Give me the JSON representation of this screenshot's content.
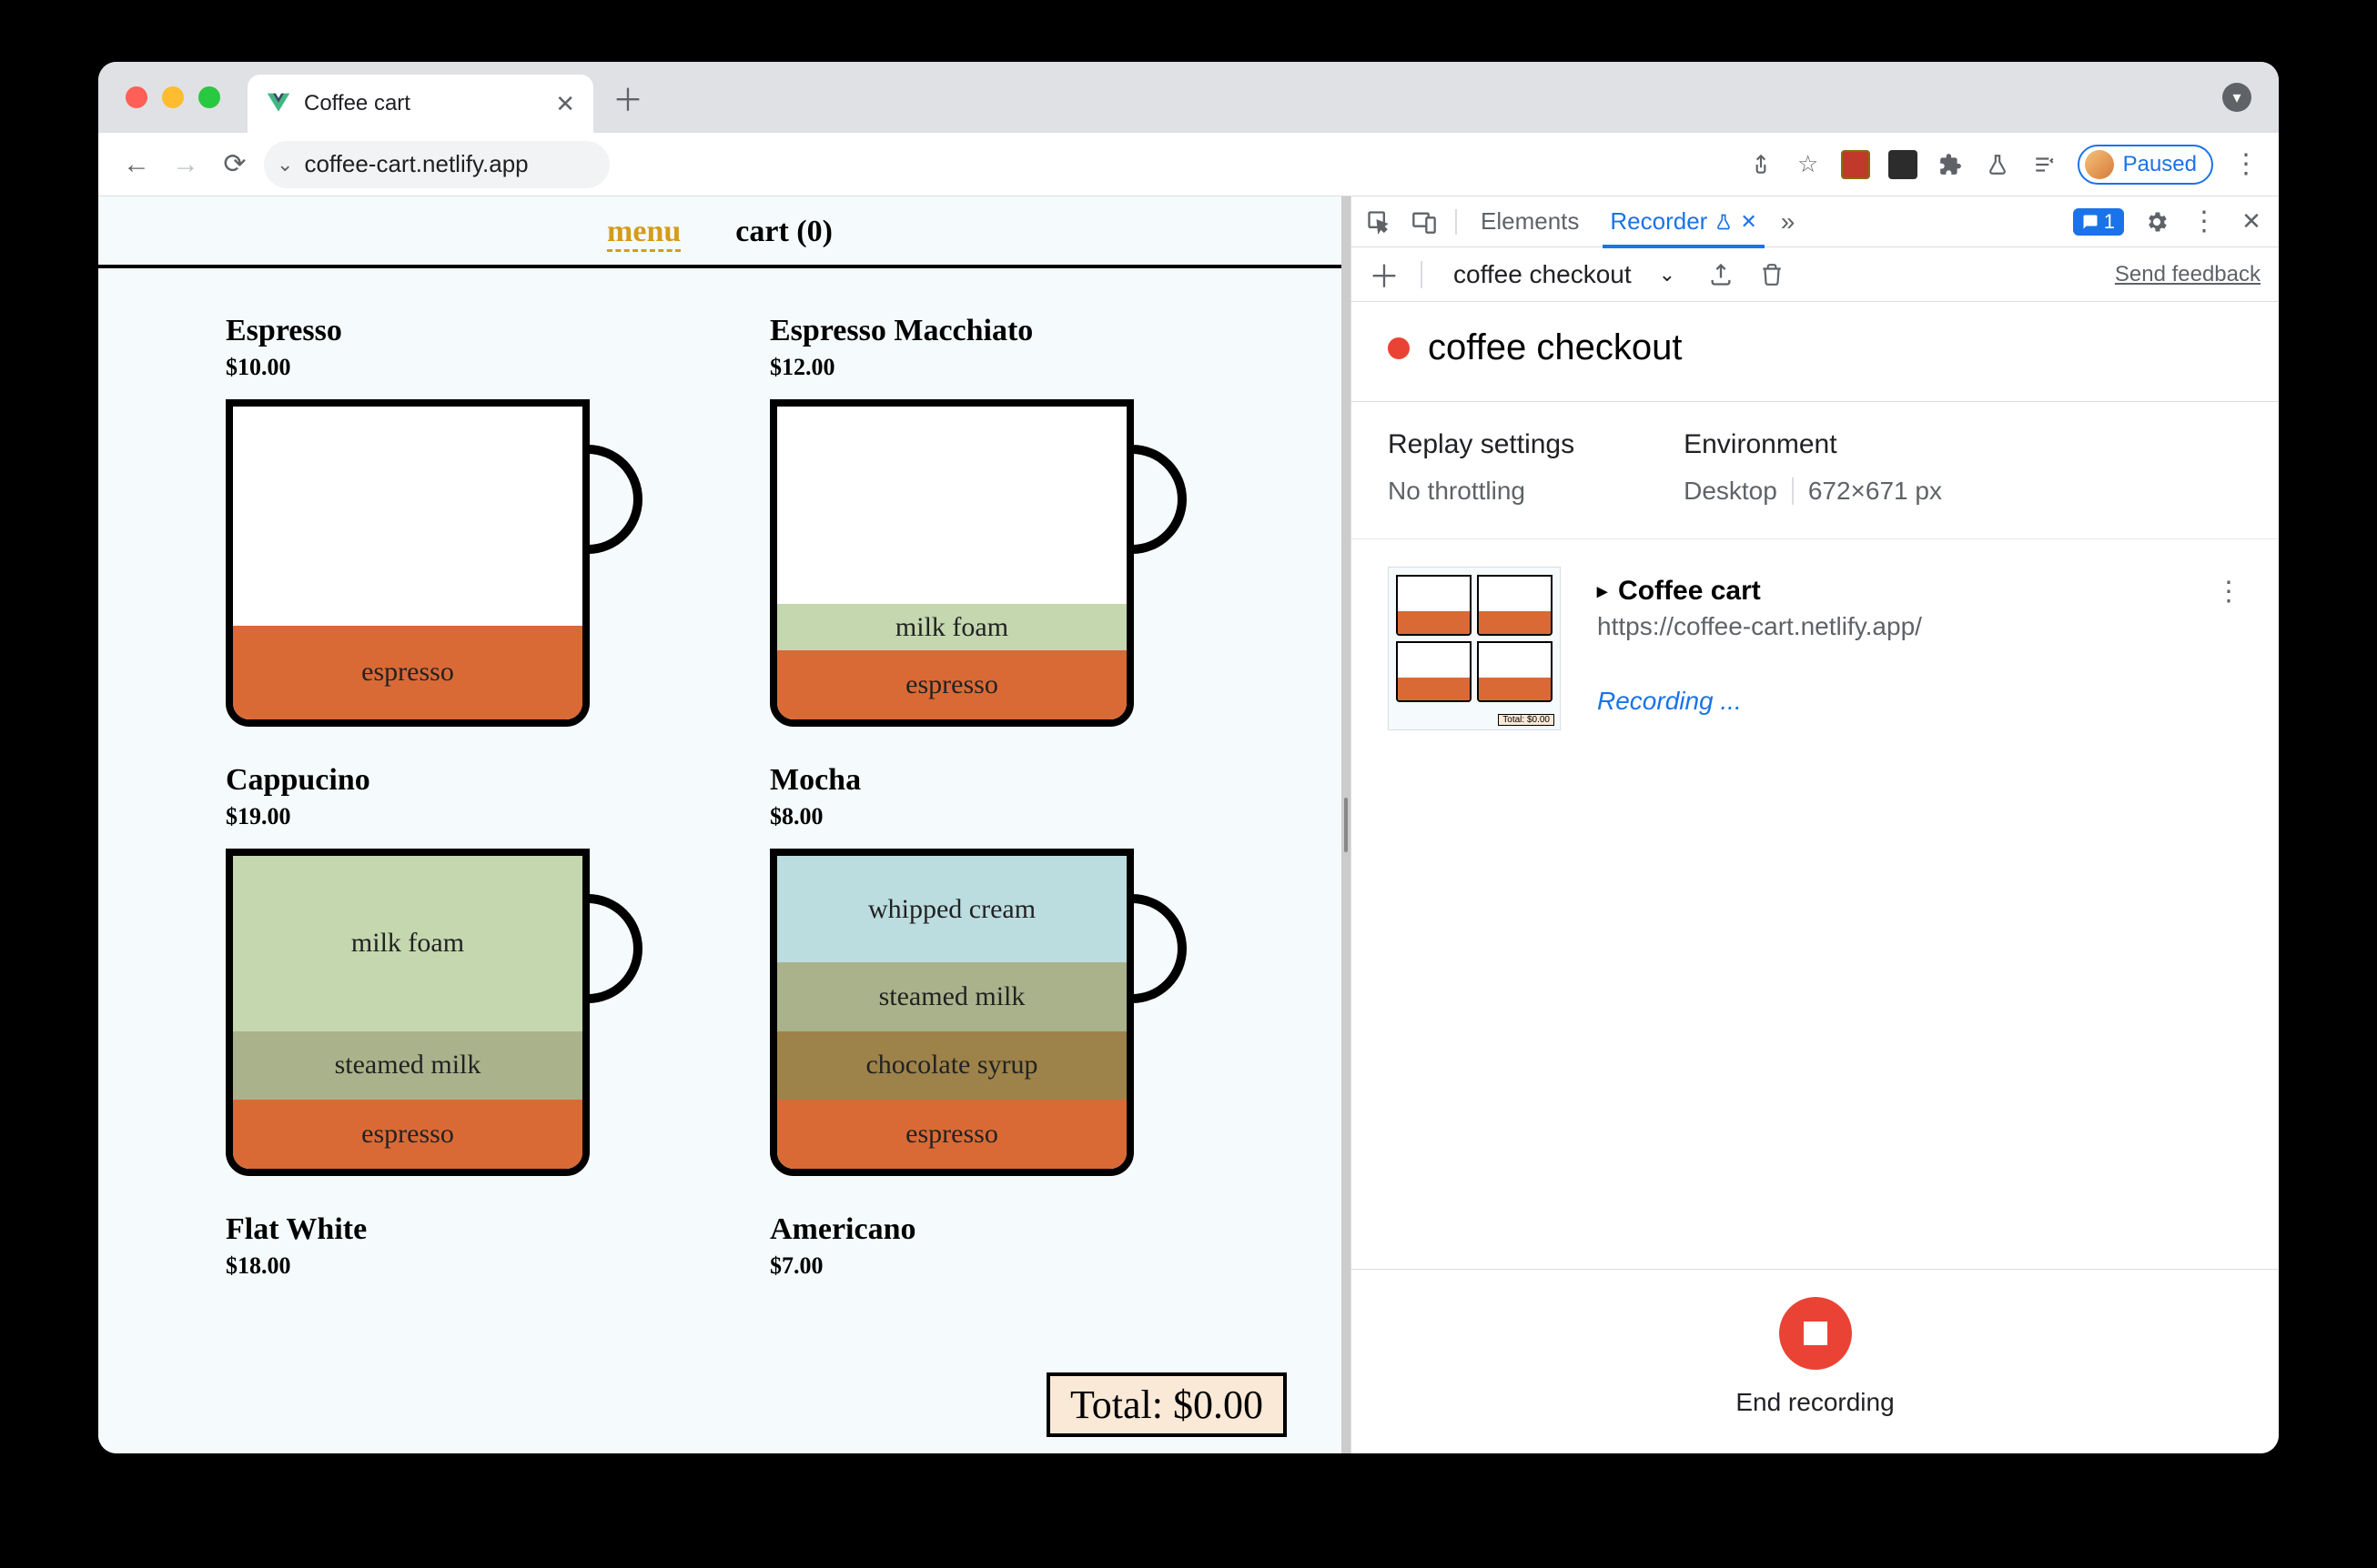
{
  "browser": {
    "tab_title": "Coffee cart",
    "url": "coffee-cart.netlify.app",
    "profile_status": "Paused"
  },
  "page": {
    "nav": {
      "menu_label": "menu",
      "cart_label": "cart (0)"
    },
    "items": [
      {
        "name": "Espresso",
        "price": "$10.00"
      },
      {
        "name": "Espresso Macchiato",
        "price": "$12.00"
      },
      {
        "name": "Cappucino",
        "price": "$19.00"
      },
      {
        "name": "Mocha",
        "price": "$8.00"
      },
      {
        "name": "Flat White",
        "price": "$18.00"
      },
      {
        "name": "Americano",
        "price": "$7.00"
      }
    ],
    "layers": {
      "espresso": "espresso",
      "milk_foam": "milk foam",
      "steamed_milk": "steamed milk",
      "chocolate_syrup": "chocolate syrup",
      "whipped_cream": "whipped cream"
    },
    "total_label": "Total: $0.00"
  },
  "devtools": {
    "tabs": {
      "elements": "Elements",
      "recorder": "Recorder"
    },
    "messages_badge": "1",
    "toolbar": {
      "recording_name": "coffee checkout",
      "feedback": "Send feedback"
    },
    "title": "coffee checkout",
    "settings": {
      "replay_heading": "Replay settings",
      "replay_value": "No throttling",
      "env_heading": "Environment",
      "env_device": "Desktop",
      "env_size": "672×671 px"
    },
    "step": {
      "title": "Coffee cart",
      "url": "https://coffee-cart.netlify.app/",
      "status": "Recording ..."
    },
    "stop_label": "End recording"
  }
}
